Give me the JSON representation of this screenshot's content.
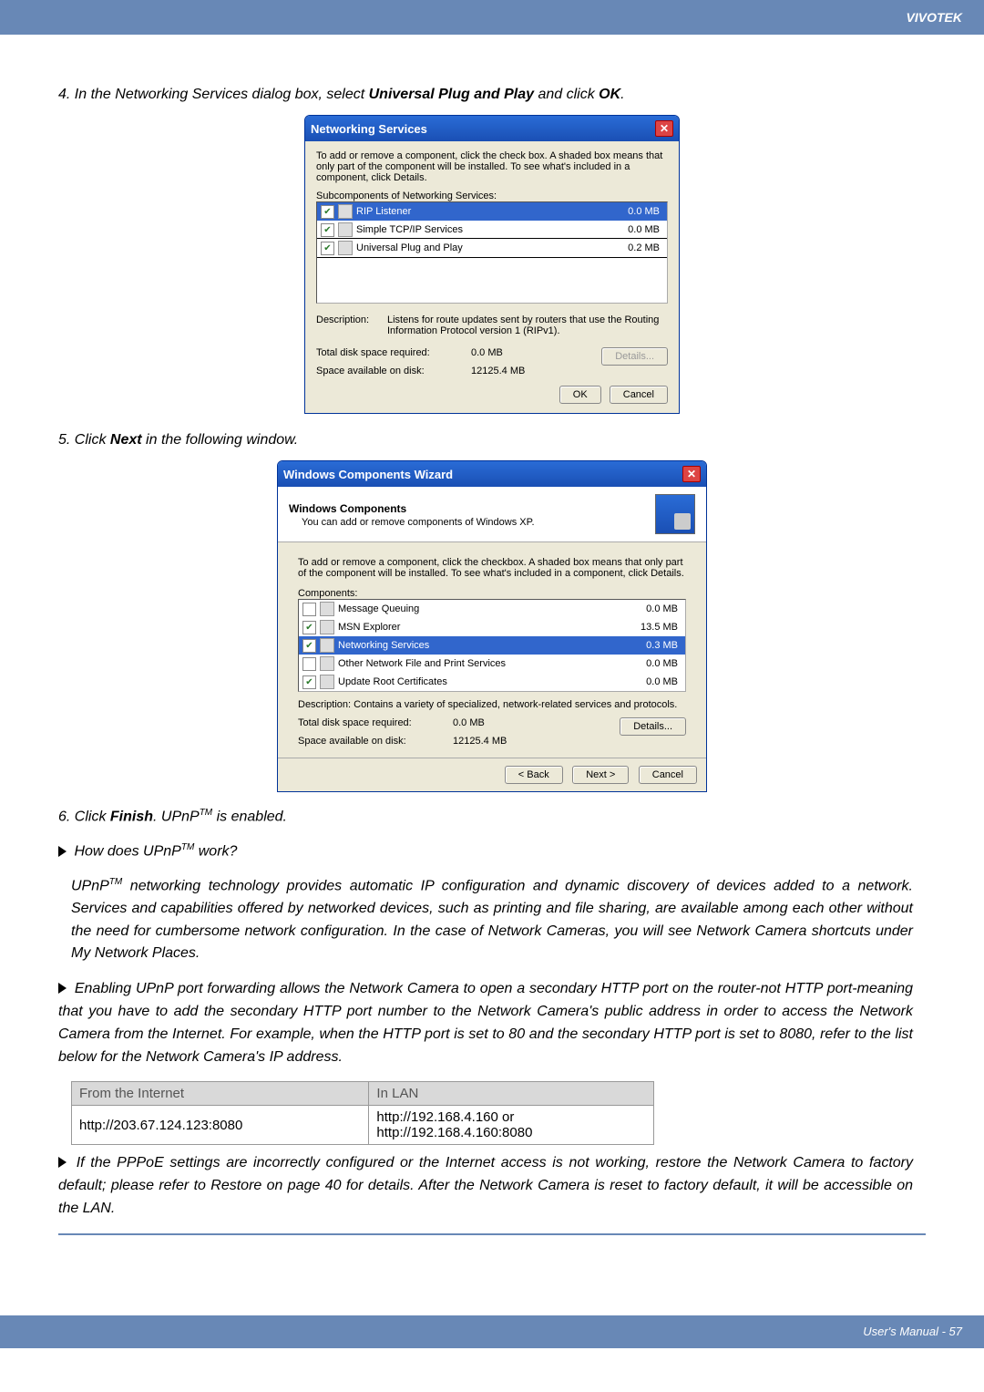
{
  "brand": "VIVOTEK",
  "step4": "4. In the Networking Services dialog box, select Universal Plug and Play and click OK.",
  "step4_bold1": "Universal Plug and Play",
  "step4_bold2": "OK",
  "ns_dialog": {
    "title": "Networking Services",
    "intro": "To add or remove a component, click the check box. A shaded box means that only part of the component will be installed. To see what's included in a component, click Details.",
    "sub_label": "Subcomponents of Networking Services:",
    "rows": [
      {
        "name": "RIP Listener",
        "size": "0.0 MB"
      },
      {
        "name": "Simple TCP/IP Services",
        "size": "0.0 MB"
      },
      {
        "name": "Universal Plug and Play",
        "size": "0.2 MB"
      }
    ],
    "desc_label": "Description:",
    "desc_text": "Listens for route updates sent by routers that use the Routing Information Protocol version 1 (RIPv1).",
    "total_label": "Total disk space required:",
    "total_val": "0.0 MB",
    "avail_label": "Space available on disk:",
    "avail_val": "12125.4 MB",
    "details_btn": "Details...",
    "ok_btn": "OK",
    "cancel_btn": "Cancel"
  },
  "step5": "5. Click Next in the following window.",
  "step5_bold": "Next",
  "wiz": {
    "title": "Windows Components Wizard",
    "header_b": "Windows Components",
    "header_sub": "You can add or remove components of Windows XP.",
    "intro": "To add or remove a component, click the checkbox. A shaded box means that only part of the component will be installed. To see what's included in a component, click Details.",
    "comp_label": "Components:",
    "rows": [
      {
        "name": "Message Queuing",
        "size": "0.0 MB"
      },
      {
        "name": "MSN Explorer",
        "size": "13.5 MB"
      },
      {
        "name": "Networking Services",
        "size": "0.3 MB"
      },
      {
        "name": "Other Network File and Print Services",
        "size": "0.0 MB"
      },
      {
        "name": "Update Root Certificates",
        "size": "0.0 MB"
      }
    ],
    "desc": "Description:  Contains a variety of specialized, network-related services and protocols.",
    "total_label": "Total disk space required:",
    "total_val": "0.0 MB",
    "avail_label": "Space available on disk:",
    "avail_val": "12125.4 MB",
    "details_btn": "Details...",
    "back_btn": "< Back",
    "next_btn": "Next >",
    "cancel_btn": "Cancel"
  },
  "step6_a": "6. Click ",
  "step6_b": "Finish",
  "step6_c": ". UPnP",
  "step6_d": " is enabled.",
  "q1_prefix": "How does UPnP",
  "q1_suffix": " work?",
  "para1": "UPnPTM networking technology provides automatic IP configuration and dynamic discovery of devices added to a network. Services and capabilities offered by networked devices, such as printing and file sharing, are available among each other without the need for cumbersome network configuration. In the case of Network Cameras, you will see Network Camera shortcuts under My Network Places.",
  "para2": "Enabling UPnP port forwarding allows the Network Camera to open a secondary HTTP port on the router-not HTTP port-meaning that you have to add the secondary HTTP port number to the Network Camera's public address in order to access the Network Camera from the Internet. For example, when the HTTP port is set to 80 and the secondary HTTP port is set to 8080, refer to the list below for the Network Camera's IP address.",
  "table": {
    "h1": "From the Internet",
    "h2": "In LAN",
    "c1": "http://203.67.124.123:8080",
    "c2a": "http://192.168.4.160 or",
    "c2b": "http://192.168.4.160:8080"
  },
  "para3": "If the PPPoE settings are incorrectly configured or the Internet access is not working, restore the Network Camera to factory default; please refer to Restore on page 40 for details. After the Network Camera is reset to factory default, it will be accessible on the LAN.",
  "footer": "User's Manual - 57"
}
